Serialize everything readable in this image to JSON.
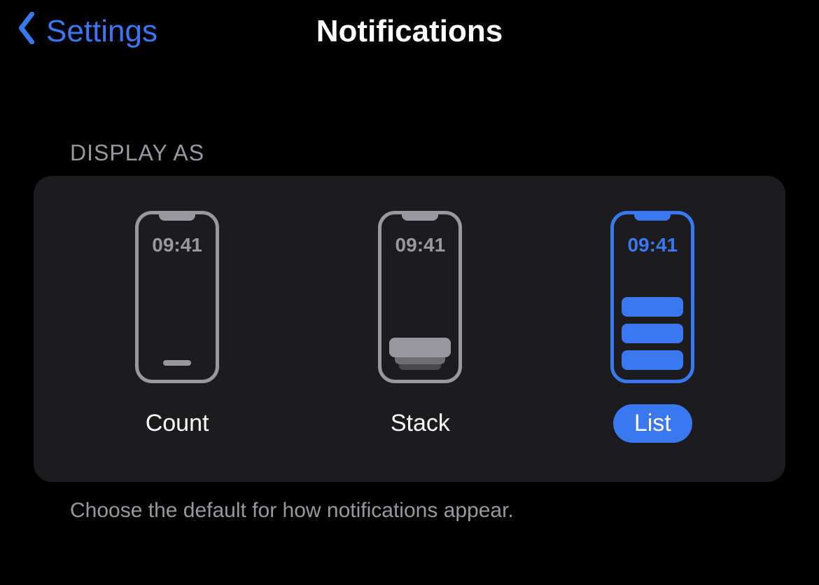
{
  "header": {
    "back_label": "Settings",
    "title": "Notifications"
  },
  "display_as": {
    "section_label": "DISPLAY AS",
    "clock": "09:41",
    "options": [
      {
        "id": "count",
        "label": "Count",
        "selected": false
      },
      {
        "id": "stack",
        "label": "Stack",
        "selected": false
      },
      {
        "id": "list",
        "label": "List",
        "selected": true
      }
    ],
    "footer": "Choose the default for how notifications appear."
  },
  "colors": {
    "accent": "#3a78f2",
    "muted": "#98989e",
    "card": "#1c1c1e",
    "bg": "#000000"
  }
}
